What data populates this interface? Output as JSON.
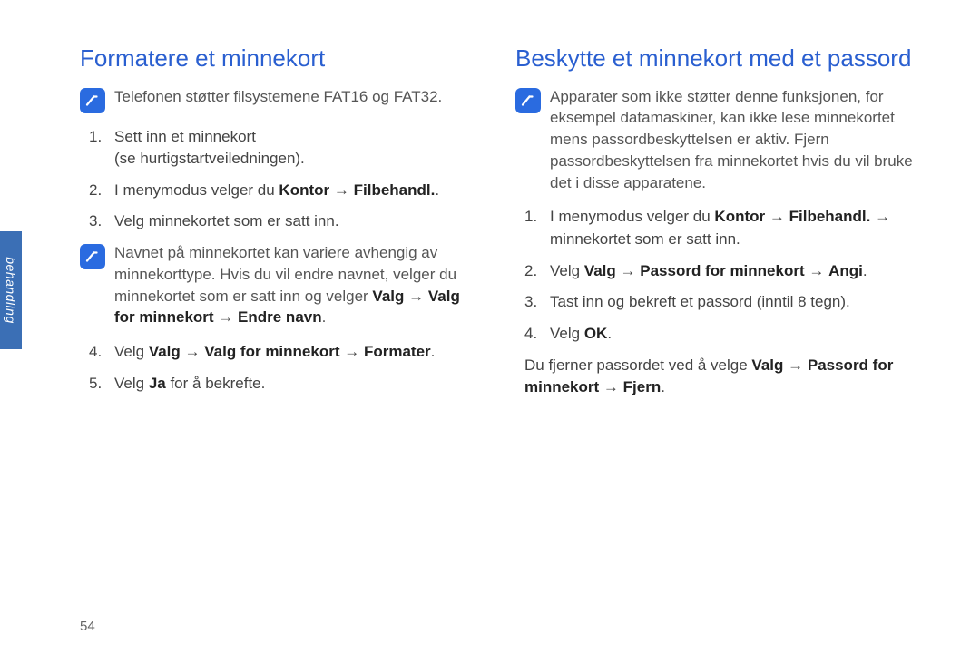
{
  "sideTab": "behandling",
  "pageNumber": "54",
  "arrow": "→",
  "left": {
    "title": "Formatere et minnekort",
    "note1": "Telefonen støtter filsystemene FAT16 og FAT32.",
    "step1_line1": "Sett inn et minnekort",
    "step1_line2": "(se hurtigstartveiledningen).",
    "step2_pre": "I menymodus velger du ",
    "step2_b1": "Kontor",
    "step2_b2": "Filbehandl.",
    "step2_post": ".",
    "step3": "Velg minnekortet som er satt inn.",
    "note2_a": "Navnet på minnekortet kan variere avhengig av minnekorttype. Hvis du vil endre navnet, velger du minnekortet som er satt inn og velger ",
    "note2_b1": "Valg",
    "note2_b2": "Valg for minnekort",
    "note2_b3": "Endre navn",
    "step4_pre": "Velg ",
    "step4_b1": "Valg",
    "step4_b2": "Valg for minnekort",
    "step4_b3": "Formater",
    "step5_pre": "Velg ",
    "step5_b1": "Ja",
    "step5_post": " for å bekrefte."
  },
  "right": {
    "title": "Beskytte et minnekort med et passord",
    "note1": "Apparater som ikke støtter denne funksjonen, for eksempel datamaskiner, kan ikke lese minnekortet mens passordbeskyttelsen er aktiv. Fjern passordbeskyttelsen fra minnekortet hvis du vil bruke det i disse apparatene.",
    "step1_pre": "I menymodus velger du ",
    "step1_b1": "Kontor",
    "step1_b2": "Filbehandl.",
    "step1_post": " minnekortet som er satt inn.",
    "step2_pre": "Velg ",
    "step2_b1": "Valg",
    "step2_b2": "Passord for minnekort",
    "step2_b3": "Angi",
    "step3": "Tast inn og bekreft et passord (inntil 8 tegn).",
    "step4_pre": "Velg ",
    "step4_b1": "OK",
    "para_pre": "Du fjerner passordet ved å velge ",
    "para_b1": "Valg",
    "para_b2": "Passord for minnekort",
    "para_b3": "Fjern"
  }
}
